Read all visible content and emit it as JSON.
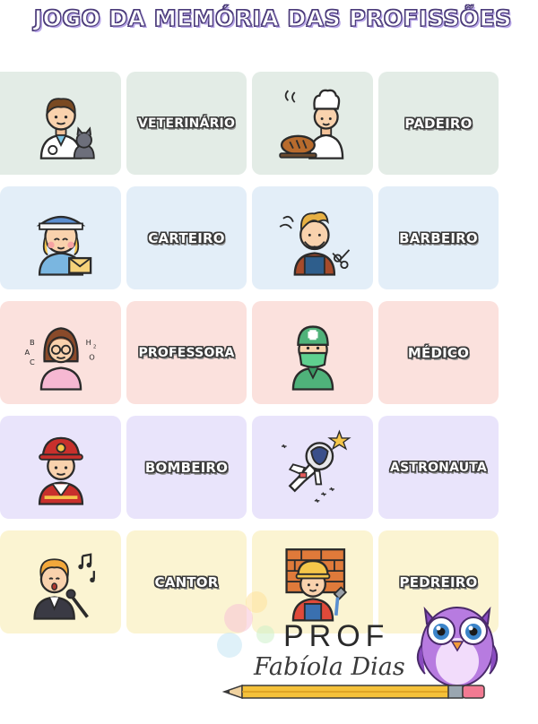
{
  "page": {
    "title": "JOGO DA MEMÓRIA DAS PROFISSÕES"
  },
  "cards": [
    {
      "kind": "picture",
      "icon": "veterinarian-icon",
      "bg": "#e3ece6"
    },
    {
      "kind": "word",
      "text": "VETERINÁRIO",
      "bg": "#e3ece6"
    },
    {
      "kind": "picture",
      "icon": "baker-icon",
      "bg": "#e3ece6"
    },
    {
      "kind": "word",
      "text": "PADEIRO",
      "bg": "#e3ece6"
    },
    {
      "kind": "picture",
      "icon": "mail-carrier-icon",
      "bg": "#e3eef8"
    },
    {
      "kind": "word",
      "text": "CARTEIRO",
      "bg": "#e3eef8"
    },
    {
      "kind": "picture",
      "icon": "barber-icon",
      "bg": "#e3eef8"
    },
    {
      "kind": "word",
      "text": "BARBEIRO",
      "bg": "#e3eef8"
    },
    {
      "kind": "picture",
      "icon": "teacher-icon",
      "bg": "#fbe1dd"
    },
    {
      "kind": "word",
      "text": "PROFESSORA",
      "bg": "#fbe1dd"
    },
    {
      "kind": "picture",
      "icon": "doctor-icon",
      "bg": "#fbe1dd"
    },
    {
      "kind": "word",
      "text": "MÉDICO",
      "bg": "#fbe1dd"
    },
    {
      "kind": "picture",
      "icon": "firefighter-icon",
      "bg": "#e9e4fb"
    },
    {
      "kind": "word",
      "text": "BOMBEIRO",
      "bg": "#e9e4fb"
    },
    {
      "kind": "picture",
      "icon": "astronaut-icon",
      "bg": "#e9e4fb"
    },
    {
      "kind": "word",
      "text": "ASTRONAUTA",
      "bg": "#e9e4fb"
    },
    {
      "kind": "picture",
      "icon": "singer-icon",
      "bg": "#fbf4d2"
    },
    {
      "kind": "word",
      "text": "CANTOR",
      "bg": "#fbf4d2"
    },
    {
      "kind": "picture",
      "icon": "bricklayer-icon",
      "bg": "#fbf4d2"
    },
    {
      "kind": "word",
      "text": "PEDREIRO",
      "bg": "#fbf4d2"
    }
  ],
  "watermark": {
    "prof": "PROF",
    "name": "Fabíola Dias",
    "icons": [
      "owl-icon",
      "pencil-icon"
    ]
  },
  "teacher_card_letters": [
    "B",
    "A",
    "C",
    "H",
    "2",
    "O"
  ]
}
